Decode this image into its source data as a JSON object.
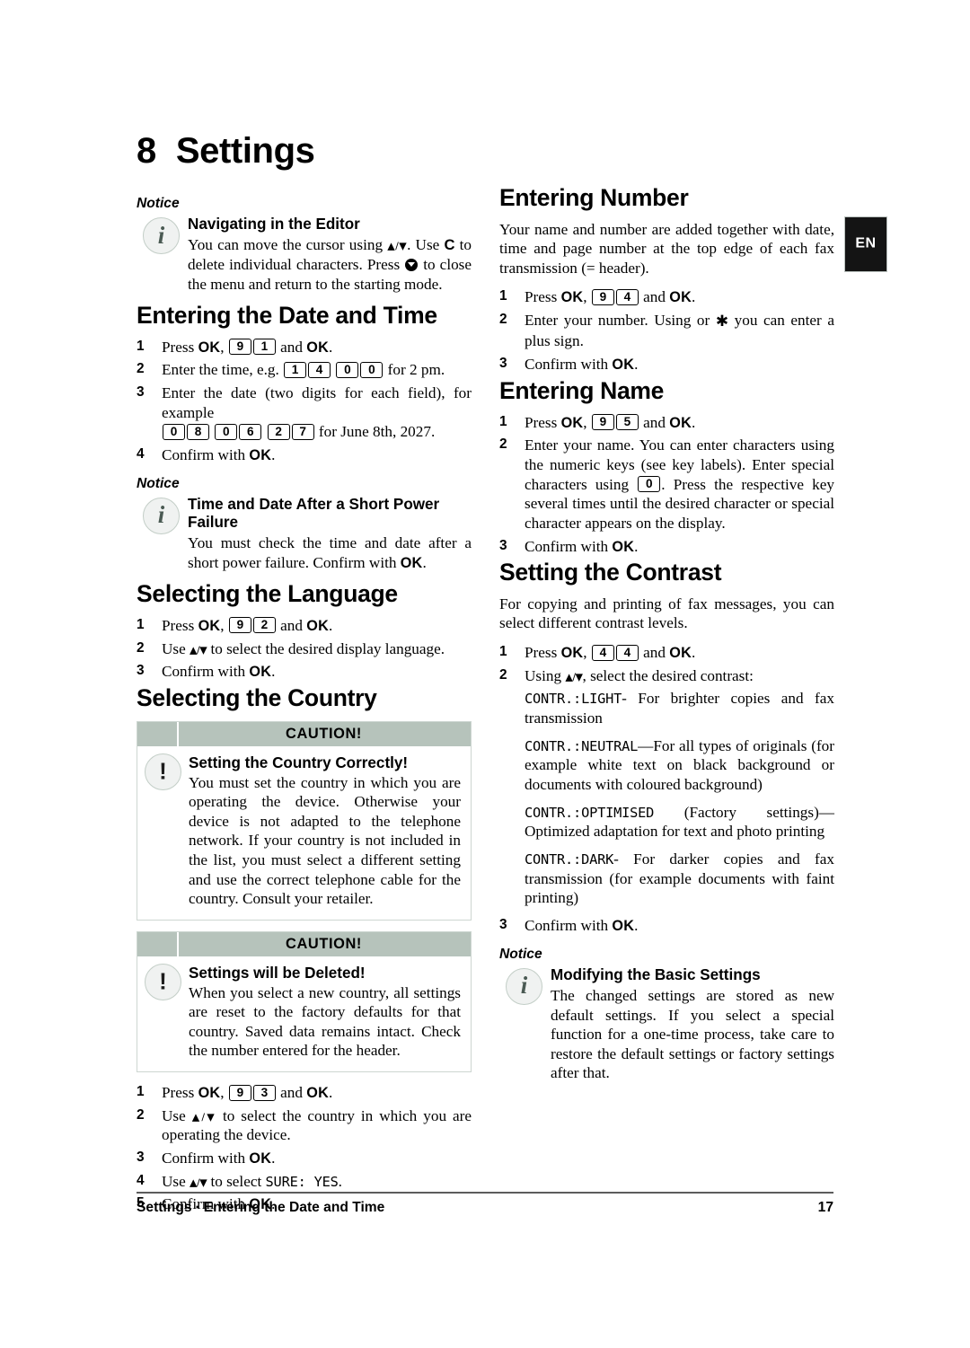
{
  "document": {
    "chapter_number": "8",
    "chapter_title": "Settings",
    "language_tab": "EN",
    "footer": {
      "left_primary": "Settings",
      "separator": "·",
      "left_secondary": "Entering the Date and Time",
      "page_number": "17"
    },
    "accent_colors": {
      "caution_header_bg": "#b6c3bb",
      "caution_border": "#cdd6d1",
      "icon_circle_bg": "#f0f2f1",
      "icon_circle_border": "#c3cec7",
      "lang_tab_bg": "#141414",
      "footer_rule": "#5c5c5c"
    }
  },
  "left_column": {
    "notice_editor": {
      "label": "Notice",
      "title": "Navigating in the Editor",
      "text_part1": "You can move the cursor using ",
      "arrows": "▲/▼",
      "text_part2": ". Use ",
      "c_key": "C",
      "text_part3": " to delete individual characters. Press ",
      "text_part4": " to close the menu and return to the starting mode."
    },
    "date_time": {
      "heading": "Entering the Date and Time",
      "steps": [
        {
          "n": "1",
          "pre": "Press ",
          "ok1": "OK",
          "comma": ", ",
          "keys": [
            "9",
            "1"
          ],
          "mid": " and ",
          "ok2": "OK",
          "post": "."
        },
        {
          "n": "2",
          "pre": "Enter the time, e.g. ",
          "keys": [
            "1",
            "4",
            "0",
            "0"
          ],
          "post": " for 2 pm."
        },
        {
          "n": "3",
          "pre": "Enter the date (two digits for each field), for example ",
          "keys": [
            "0",
            "8",
            "0",
            "6",
            "2",
            "7"
          ],
          "post": " for June 8th, 2027."
        },
        {
          "n": "4",
          "pre": "Confirm with ",
          "ok1": "OK",
          "post": "."
        }
      ]
    },
    "notice_power": {
      "label": "Notice",
      "title": "Time and Date After a Short Power Failure",
      "text_pre": "You must check the time and date after a short power failure. Confirm with ",
      "ok": "OK",
      "text_post": "."
    },
    "language": {
      "heading": "Selecting the Language",
      "steps": [
        {
          "n": "1",
          "pre": "Press ",
          "ok1": "OK",
          "comma": ", ",
          "keys": [
            "9",
            "2"
          ],
          "mid": " and ",
          "ok2": "OK",
          "post": "."
        },
        {
          "n": "2",
          "pre": "Use ",
          "arrows": "▲/▼",
          "post": " to select the desired display language."
        },
        {
          "n": "3",
          "pre": "Confirm with ",
          "ok1": "OK",
          "post": "."
        }
      ]
    },
    "country": {
      "heading": "Selecting the Country",
      "caution_1": {
        "header": "CAUTION!",
        "title": "Setting the Country Correctly!",
        "text": "You must set the country in which you are operating the device. Otherwise your device is not adapted to the telephone network. If your country is not included in the list, you must select a different setting and use the correct telephone cable for the country. Consult your retailer."
      },
      "caution_2": {
        "header": "CAUTION!",
        "title": "Settings will be Deleted!",
        "text": "When you select a new country, all settings are reset to the factory defaults for that country. Saved data remains intact. Check the number entered for the header."
      },
      "steps": [
        {
          "n": "1",
          "pre": "Press ",
          "ok1": "OK",
          "comma": ", ",
          "keys": [
            "9",
            "3"
          ],
          "mid": " and ",
          "ok2": "OK",
          "post": "."
        },
        {
          "n": "2",
          "pre": "Use ",
          "arrows": "▲/▼",
          "post": " to select the country in which you are operating the device."
        },
        {
          "n": "3",
          "pre": "Confirm with ",
          "ok1": "OK",
          "post": "."
        },
        {
          "n": "4",
          "pre": "Use ",
          "arrows": "▲/▼",
          "mid": " to select ",
          "mono": "SURE: YES",
          "post": "."
        },
        {
          "n": "5",
          "pre": "Confirm with ",
          "ok1": "OK",
          "post": "."
        }
      ]
    }
  },
  "right_column": {
    "number": {
      "heading": "Entering Number",
      "intro": "Your name and number are added together with date, time and page number at the top edge of each fax transmission (= header).",
      "steps": [
        {
          "n": "1",
          "pre": "Press ",
          "ok1": "OK",
          "comma": ", ",
          "keys": [
            "9",
            "4"
          ],
          "mid": " and ",
          "ok2": "OK",
          "post": "."
        },
        {
          "n": "2",
          "pre": "Enter your number. Using  or ",
          "star": "✱",
          "post": " you can enter a plus sign."
        },
        {
          "n": "3",
          "pre": "Confirm with ",
          "ok1": "OK",
          "post": "."
        }
      ]
    },
    "name": {
      "heading": "Entering Name",
      "steps": [
        {
          "n": "1",
          "pre": "Press ",
          "ok1": "OK",
          "comma": ", ",
          "keys": [
            "9",
            "5"
          ],
          "mid": " and ",
          "ok2": "OK",
          "post": "."
        },
        {
          "n": "2",
          "pre": "Enter your name. You can enter characters using the numeric keys (see key labels).  Enter special characters using ",
          "keys": [
            "0"
          ],
          "post": ". Press the respective key several times until the desired character or special character appears on the display."
        },
        {
          "n": "3",
          "pre": "Confirm with ",
          "ok1": "OK",
          "post": "."
        }
      ]
    },
    "contrast": {
      "heading": "Setting the Contrast",
      "intro": "For copying and printing of fax messages, you can select different contrast levels.",
      "step1": {
        "n": "1",
        "pre": "Press ",
        "ok1": "OK",
        "comma": ", ",
        "keys": [
          "4",
          "4"
        ],
        "mid": " and ",
        "ok2": "OK",
        "post": "."
      },
      "step2": {
        "n": "2",
        "pre": "Using ",
        "arrows": "▲/▼",
        "post": ", select the desired contrast:"
      },
      "options": [
        {
          "code": "CONTR.:LIGHT",
          "desc": "- For brighter copies and fax transmission"
        },
        {
          "code": "CONTR.:NEUTRAL",
          "desc": "—For all types of originals (for example white text on black background or documents with coloured background)"
        },
        {
          "code": "CONTR.:OPTIMISED",
          "desc": " (Factory settings)—Optimized adaptation for text and photo printing"
        },
        {
          "code": "CONTR.:DARK",
          "desc": "- For darker copies and fax transmission (for example documents with faint printing)"
        }
      ],
      "step3": {
        "n": "3",
        "pre": "Confirm with ",
        "ok1": "OK",
        "post": "."
      }
    },
    "notice_basic": {
      "label": "Notice",
      "title": "Modifying the Basic Settings",
      "text": "The changed settings are stored as new default settings. If you select a special function for a one-time process, take care to restore the default settings or factory settings after that."
    }
  }
}
